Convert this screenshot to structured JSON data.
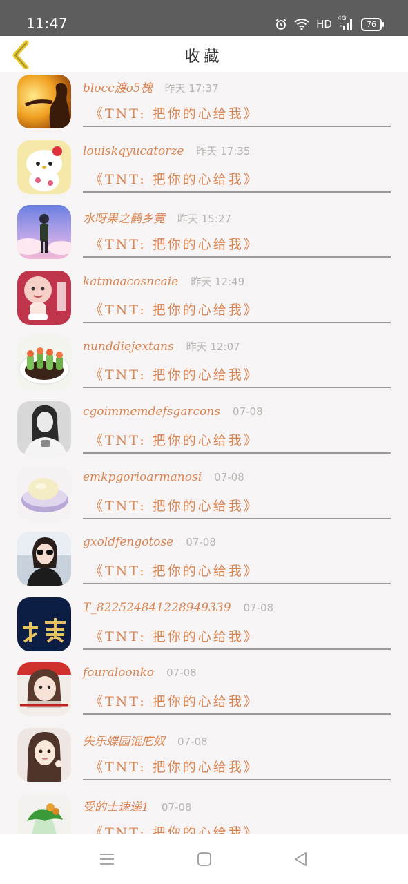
{
  "status_bar": {
    "time": "11:47",
    "network": "HD",
    "signal": "4G",
    "battery": "76"
  },
  "header": {
    "title": "收藏",
    "back_icon": "chevron-left-icon"
  },
  "items": [
    {
      "name": "blocc渡o5槐",
      "time": "昨天 17:37",
      "title": "《TNT: 把你的心给我》",
      "avatar": "silhouette-sunset"
    },
    {
      "name": "louiskqyucatorze",
      "time": "昨天 17:35",
      "title": "《TNT: 把你的心给我》",
      "avatar": "hello-kitty"
    },
    {
      "name": "水呀果之鹤乡竟",
      "time": "昨天 15:27",
      "title": "《TNT: 把你的心给我》",
      "avatar": "anime-figure-sky"
    },
    {
      "name": "katmaacosncaie",
      "time": "昨天 12:49",
      "title": "《TNT: 把你的心给我》",
      "avatar": "cartoon-baby"
    },
    {
      "name": "nunddiejextans",
      "time": "昨天 12:07",
      "title": "《TNT: 把你的心给我》",
      "avatar": "food-plate"
    },
    {
      "name": "cgoimmemdefsgarcons",
      "time": "07-08",
      "title": "《TNT: 把你的心给我》",
      "avatar": "girl-grayscale"
    },
    {
      "name": "emkpgorioarmanosi",
      "time": "07-08",
      "title": "《TNT: 把你的心给我》",
      "avatar": "dessert-bowl"
    },
    {
      "name": "gxoldfengotose",
      "time": "07-08",
      "title": "《TNT: 把你的心给我》",
      "avatar": "girl-sunglasses"
    },
    {
      "name": "T_8225248412289493​39",
      "time": "07-08",
      "title": "《TNT: 把你的心给我》",
      "avatar": "text-tianzhen"
    },
    {
      "name": "fouraloonko",
      "time": "07-08",
      "title": "《TNT: 把你的心给我》",
      "avatar": "girl-selfie"
    },
    {
      "name": "失乐蝶园馄庀奴",
      "time": "07-08",
      "title": "《TNT: 把你的心给我》",
      "avatar": "girl-doll"
    },
    {
      "name": "受的士速递1",
      "time": "07-08",
      "title": "《TNT: 把你的心给我》",
      "avatar": "jade-cabbage"
    }
  ],
  "nav_bar": {
    "menu_icon": "menu-icon",
    "home_icon": "home-square-icon",
    "back_icon": "back-triangle-icon"
  }
}
